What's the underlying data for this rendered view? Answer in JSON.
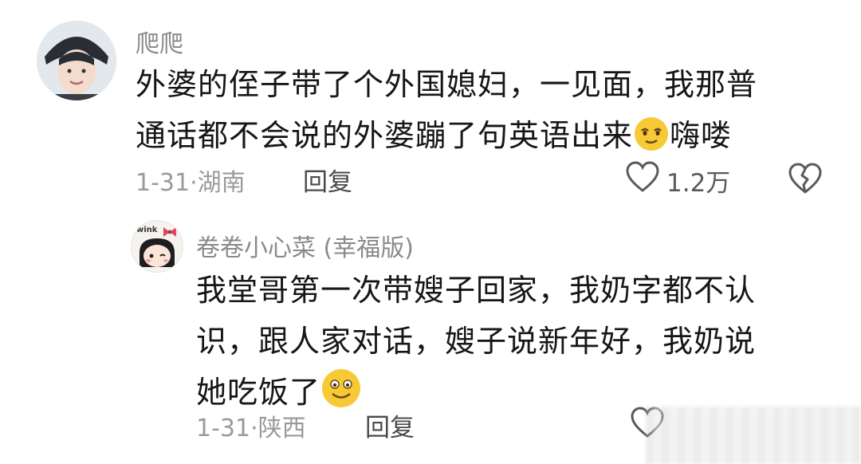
{
  "comments": [
    {
      "username": "爬爬",
      "lines": [
        "外婆的侄子带了个外国媳妇，一见面，我那普",
        "通话都不会说的外婆蹦了句英语出来",
        "嗨喽"
      ],
      "date_location": "1-31·湖南",
      "reply_label": "回复",
      "like_count": "1.2万",
      "emoji": "smirk-face-emoji"
    }
  ],
  "replies": [
    {
      "username": "卷卷小心菜 (幸福版)",
      "avatar_text": "wink",
      "lines": [
        "我堂哥第一次带嫂子回家，我奶字都不认",
        "识，跟人家对话，嫂子说新年好，我奶说",
        "她吃饭了"
      ],
      "date_location": "1-31·陕西",
      "reply_label": "回复",
      "emoji": "smiling-face-emoji"
    }
  ],
  "colors": {
    "text": "#161616",
    "muted": "#9a9a9a",
    "emoji_yellow": "#f7c934"
  }
}
